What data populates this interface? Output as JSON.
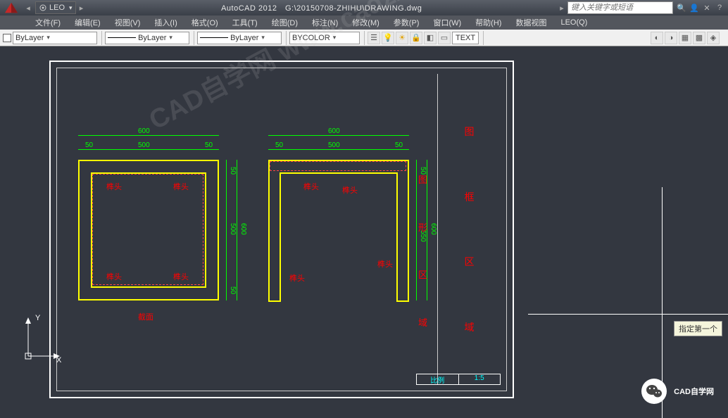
{
  "titlebar": {
    "workspace_select": "LEO",
    "app_name": "AutoCAD 2012",
    "file_path": "G:\\20150708-ZHIHU\\DRAWING.dwg",
    "search_placeholder": "键入关键字或短语"
  },
  "menu": {
    "file": "文件(F)",
    "edit": "编辑(E)",
    "view": "视图(V)",
    "insert": "插入(I)",
    "format": "格式(O)",
    "tool": "工具(T)",
    "draw": "绘图(D)",
    "dimension": "标注(N)",
    "modify": "修改(M)",
    "params": "参数(P)",
    "window": "窗口(W)",
    "help": "帮助(H)",
    "dataview": "数据视图",
    "leo": "LEO(Q)"
  },
  "toolbar": {
    "layer_color": "ByLayer",
    "linetype": "ByLayer",
    "lineweight": "ByLayer",
    "plotstyle": "BYCOLOR",
    "text_tool": "TEXT"
  },
  "drawing": {
    "dims": {
      "w_overall": "600",
      "w_seg1": "50",
      "w_seg2": "500",
      "w_seg3": "50",
      "h_overall": "600",
      "h_seg1": "50",
      "h_seg2": "500",
      "h_seg3": "50",
      "h2_overall": "600",
      "h2_seg1": "50",
      "h2_seg2": "550"
    },
    "annotations": {
      "a1": "榫头",
      "a2": "榫头",
      "a3": "榫头",
      "a4": "榫头",
      "b1": "榫头",
      "b2": "榫头",
      "b3": "榫头",
      "cut": "截面"
    },
    "right_col": [
      "图",
      "形",
      "区",
      "域"
    ],
    "sidebar": [
      "图",
      "框",
      "区",
      "域"
    ],
    "title_block_label": "比例",
    "title_block_scale": "1:5"
  },
  "ucs": {
    "y": "Y",
    "x": "X"
  },
  "tooltip": "指定第一个",
  "branding": "CAD自学网",
  "watermark": "CAD自学网    www.cadzxw.com"
}
